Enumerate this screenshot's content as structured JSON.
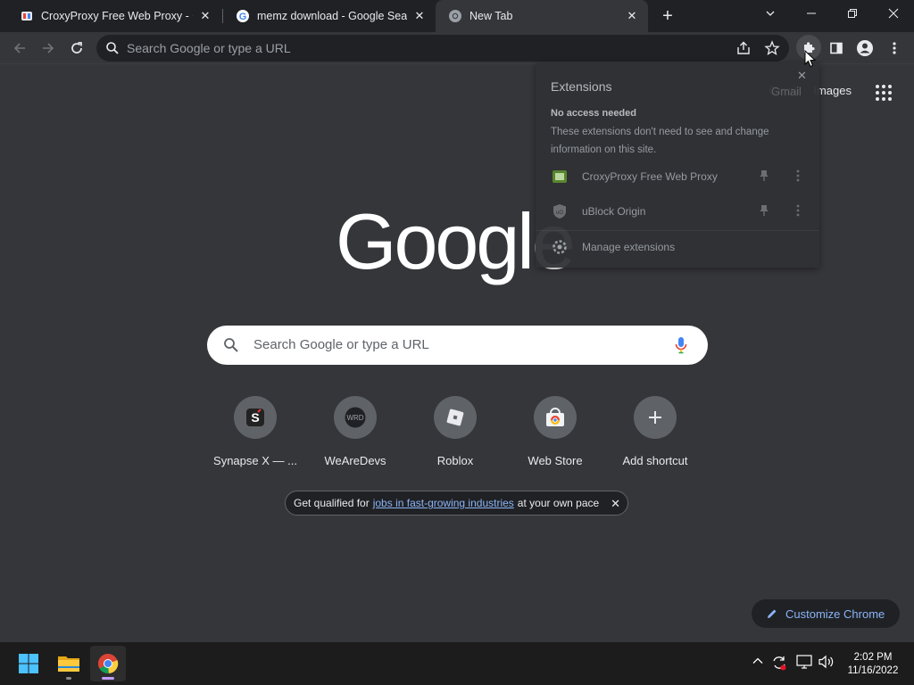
{
  "tabs": [
    {
      "title": "CroxyProxy Free Web Proxy - Chr",
      "favicon": "croxyproxy-icon",
      "active": false
    },
    {
      "title": "memz download - Google Search",
      "favicon": "google-g-icon",
      "active": false
    },
    {
      "title": "New Tab",
      "favicon": "chrome-icon",
      "active": true
    }
  ],
  "toolbar": {
    "omnibox_placeholder": "Search Google or type a URL"
  },
  "top_links": {
    "gmail": "Gmail",
    "images": "Images"
  },
  "logo_text": "Google",
  "search": {
    "placeholder": "Search Google or type a URL"
  },
  "shortcuts": [
    {
      "label": "Synapse X — ...",
      "icon": "synapse-icon"
    },
    {
      "label": "WeAreDevs",
      "icon": "wrd-icon"
    },
    {
      "label": "Roblox",
      "icon": "roblox-icon"
    },
    {
      "label": "Web Store",
      "icon": "webstore-icon"
    },
    {
      "label": "Add shortcut",
      "icon": "plus-icon"
    }
  ],
  "promo": {
    "prefix": "Get qualified for",
    "link": "jobs in fast-growing industries",
    "suffix": "at your own pace"
  },
  "customize_label": "Customize Chrome",
  "extensions_popup": {
    "title": "Extensions",
    "section_heading": "No access needed",
    "section_description": "These extensions don't need to see and change information on this site.",
    "items": [
      {
        "name": "CroxyProxy Free Web Proxy",
        "icon": "croxyproxy-icon"
      },
      {
        "name": "uBlock Origin",
        "icon": "ublock-icon"
      }
    ],
    "manage_label": "Manage extensions"
  },
  "taskbar": {
    "time": "2:02 PM",
    "date": "11/16/2022"
  },
  "colors": {
    "tabstrip": "#202124",
    "toolbar": "#35363a",
    "accent_link": "#8ab4f8",
    "taskbar": "#1c1c1c"
  }
}
